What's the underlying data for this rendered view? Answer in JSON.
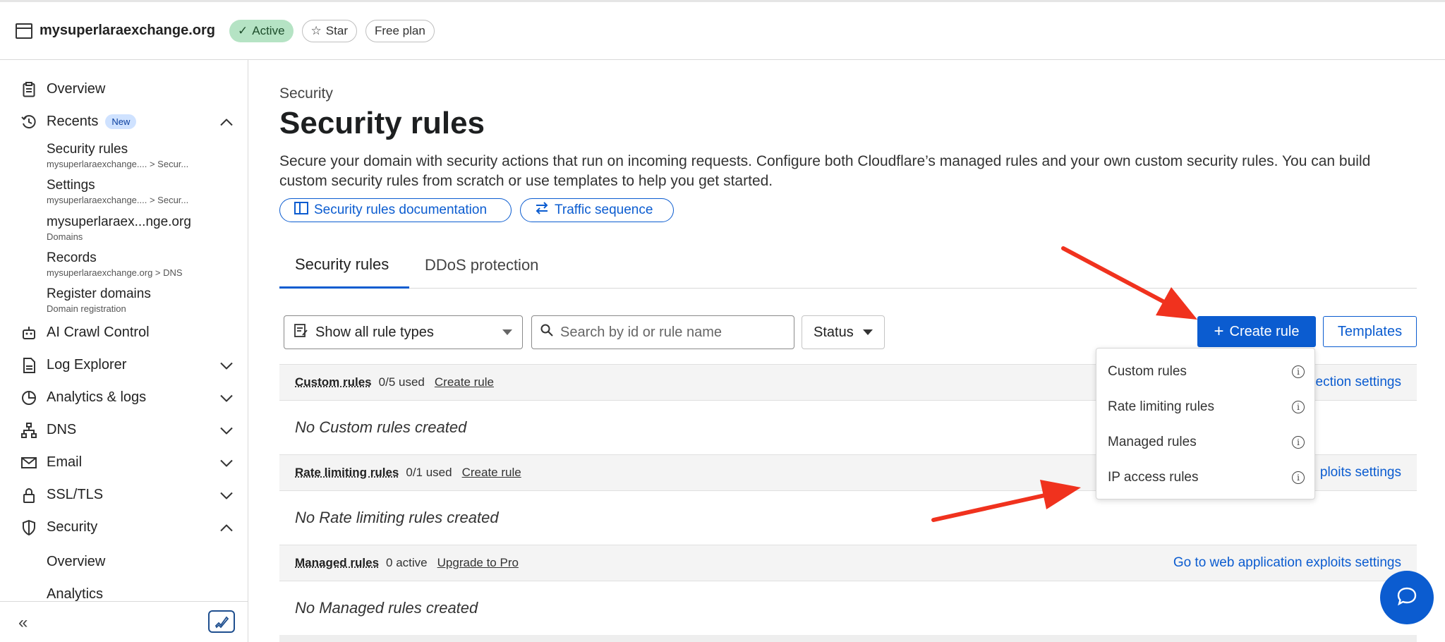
{
  "topbar": {
    "domain": "mysuperlaraexchange.org",
    "status": "Active",
    "star": "Star",
    "plan": "Free plan"
  },
  "sidebar": {
    "overview": "Overview",
    "recents": "Recents",
    "recents_badge": "New",
    "recent_items": [
      {
        "title": "Security rules",
        "sub": "mysuperlaraexchange.... > Secur..."
      },
      {
        "title": "Settings",
        "sub": "mysuperlaraexchange.... > Secur..."
      },
      {
        "title": "mysuperlaraex...nge.org",
        "sub": "Domains"
      },
      {
        "title": "Records",
        "sub": "mysuperlaraexchange.org > DNS"
      },
      {
        "title": "Register domains",
        "sub": "Domain registration"
      }
    ],
    "ai_crawl": "AI Crawl Control",
    "log_explorer": "Log Explorer",
    "analytics_logs": "Analytics & logs",
    "dns": "DNS",
    "email": "Email",
    "ssl": "SSL/TLS",
    "security": "Security",
    "security_sub": [
      "Overview",
      "Analytics"
    ]
  },
  "main": {
    "breadcrumb": "Security",
    "title": "Security rules",
    "description": "Secure your domain with security actions that run on incoming requests. Configure both Cloudflare’s managed rules and your own custom security rules. You can build custom security rules from scratch or use templates to help you get started.",
    "doc_link": "Security rules documentation",
    "traffic_link": "Traffic sequence",
    "tabs": [
      "Security rules",
      "DDoS protection"
    ],
    "filter_type": "Show all rule types",
    "search_placeholder": "Search by id or rule name",
    "status_filter": "Status",
    "create_rule": "Create rule",
    "templates": "Templates",
    "sections": [
      {
        "name": "Custom rules",
        "used": "0/5 used",
        "action": "Create rule",
        "right": "ection settings",
        "empty": "No Custom rules created"
      },
      {
        "name": "Rate limiting rules",
        "used": "0/1 used",
        "action": "Create rule",
        "right": "ploits settings",
        "empty": "No Rate limiting rules created"
      },
      {
        "name": "Managed rules",
        "used": "0 active",
        "action": "Upgrade to Pro",
        "right": "Go to web application exploits settings",
        "empty": "No Managed rules created"
      }
    ]
  },
  "dropdown": {
    "items": [
      "Custom rules",
      "Rate limiting rules",
      "Managed rules",
      "IP access rules"
    ]
  },
  "colors": {
    "accent": "#0b5cd0",
    "active_badge": "#b5e3c4",
    "annotation_arrow": "#f0321e"
  }
}
